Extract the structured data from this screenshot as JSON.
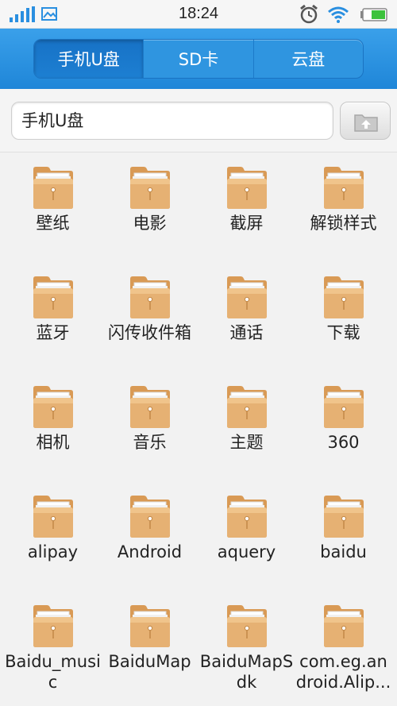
{
  "status_bar": {
    "time": "18:24",
    "icons": [
      "signal-icon",
      "picture-icon",
      "alarm-icon",
      "wifi-icon",
      "battery-icon"
    ]
  },
  "tabs": [
    {
      "label": "手机U盘",
      "active": true
    },
    {
      "label": "SD卡",
      "active": false
    },
    {
      "label": "云盘",
      "active": false
    }
  ],
  "path": {
    "value": "手机U盘",
    "up_button_icon": "folder-up-icon"
  },
  "folders": [
    "壁纸",
    "电影",
    "截屏",
    "解锁样式",
    "蓝牙",
    "闪传收件箱",
    "通话",
    "下载",
    "相机",
    "音乐",
    "主题",
    "360",
    "alipay",
    "Android",
    "aquery",
    "baidu",
    "Baidu_music",
    "BaiduMap",
    "BaiduMapSdk",
    "com.eg.android.Alip..."
  ],
  "colors": {
    "header_blue": "#2a90e0",
    "folder_tan": "#e0a968"
  }
}
